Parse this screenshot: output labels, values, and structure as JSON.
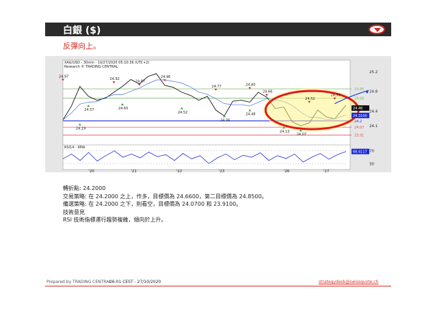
{
  "header": {
    "title": "白銀 ($)"
  },
  "subtitle": "反彈向上。",
  "notes": [
    "轉折點: 24.2000",
    "交易策略: 在 24.2000 之上，作多，目標價為 24.6600，第二目標價為 24.8500。",
    "備選策略: 在 24.2000 之下，則看空，目標價為 24.0700 和 23.9100。",
    "技術意見",
    "RSI 技術指標運行趨勢複雜，傾向於上升。"
  ],
  "footer": {
    "prepared": "Prepared by TRADING CENTRAL",
    "time": "06:01 CEST - 27/10/2020",
    "email": "strategydesk@swissquote.ch"
  },
  "colors": {
    "accent": "#d42a20",
    "header_bg": "#2b2b2b",
    "pivot": "#1a2bd6",
    "target": "#7db66a",
    "stop": "#e05050"
  },
  "chart_data": {
    "type": "line",
    "title": "XAG/USD - 30min - 10/27/2020 05:10:36 (UTC+2)",
    "subtitle": "Research © TRADING CENTRAL",
    "x_ticks": [
      "20",
      "21",
      "22",
      "23",
      "26",
      "27"
    ],
    "y_ticks": [
      25.2,
      24.8,
      24.4,
      24.1
    ],
    "ylim": [
      23.85,
      25.35
    ],
    "series": [
      {
        "x": [
          0,
          3,
          6,
          9,
          12,
          15,
          18,
          21,
          24,
          27,
          30,
          33,
          36,
          39,
          42,
          45,
          48,
          51,
          54,
          57,
          60,
          63,
          66,
          69,
          72,
          75,
          78,
          81,
          84,
          87,
          90,
          93,
          96,
          100
        ],
        "values": [
          24.22,
          24.5,
          24.9,
          24.7,
          24.62,
          24.66,
          24.78,
          24.9,
          25.04,
          24.95,
          25.1,
          25.16,
          24.92,
          24.88,
          24.78,
          24.72,
          24.62,
          24.7,
          24.42,
          24.3,
          24.6,
          24.62,
          24.58,
          24.78,
          24.68,
          24.45,
          24.48,
          24.18,
          24.1,
          24.16,
          24.42,
          24.28,
          24.24,
          24.52
        ]
      }
    ],
    "peak_labels": [
      {
        "x": 0,
        "value": 24.97,
        "text": "24.97"
      },
      {
        "x": 18,
        "value": 24.92,
        "text": "24.92"
      },
      {
        "x": 27,
        "value": 24.87,
        "text": "24.87"
      },
      {
        "x": 36,
        "value": 24.96,
        "text": "24.96"
      },
      {
        "x": 54,
        "value": 24.77,
        "text": "24.77"
      },
      {
        "x": 66,
        "value": 24.8,
        "text": "24.80"
      },
      {
        "x": 72,
        "value": 24.66,
        "text": "24.66"
      },
      {
        "x": 87,
        "value": 24.52,
        "text": "24.52"
      },
      {
        "x": 96,
        "value": 24.59,
        "text": "24.59"
      }
    ],
    "trough_labels": [
      {
        "x": 9,
        "value": 24.57,
        "text": "24.57"
      },
      {
        "x": 21,
        "value": 24.6,
        "text": "24.60"
      },
      {
        "x": 42,
        "value": 24.52,
        "text": "24.52"
      },
      {
        "x": 6,
        "value": 24.19,
        "text": "24.19"
      },
      {
        "x": 57,
        "value": 24.36,
        "text": "24.36"
      },
      {
        "x": 66,
        "value": 24.48,
        "text": "24.48"
      },
      {
        "x": 78,
        "value": 24.13,
        "text": "24.13"
      },
      {
        "x": 84,
        "value": 24.07,
        "text": "24.07"
      }
    ],
    "levels": [
      {
        "value": 24.85,
        "label": "24.85",
        "type": "target"
      },
      {
        "value": 24.66,
        "label": "24.66",
        "type": "target"
      },
      {
        "value": 24.2,
        "label": "24.2",
        "type": "pivot"
      },
      {
        "value": 24.07,
        "label": "24.07",
        "type": "stop"
      },
      {
        "value": 23.91,
        "label": "23.91",
        "type": "stop"
      }
    ],
    "right_boxes": [
      {
        "value": 24.46,
        "text": "24.46"
      },
      {
        "value": 24.31,
        "text": "24.3100"
      }
    ],
    "rsi": {
      "label": "RSI14 - 9MA",
      "y_ticks": [
        70,
        30
      ],
      "ylim": [
        20,
        80
      ],
      "value_box": "68.4117",
      "values": [
        45,
        60,
        40,
        65,
        38,
        55,
        70,
        50,
        60,
        48,
        66,
        52,
        58,
        40,
        62,
        45,
        55,
        30,
        48,
        60,
        42,
        56,
        50,
        64,
        40,
        55,
        46,
        60,
        35,
        50,
        62,
        44,
        58,
        68
      ]
    }
  }
}
